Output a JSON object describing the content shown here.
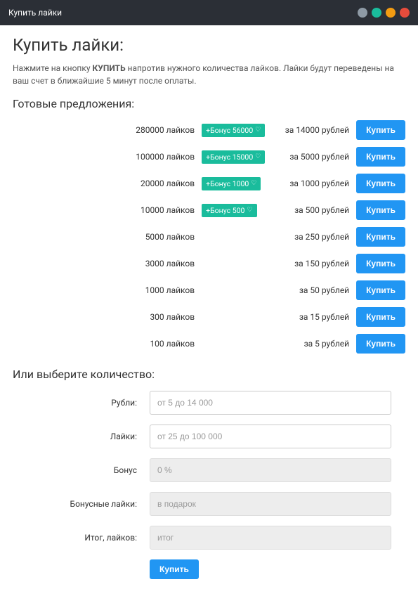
{
  "titlebar": {
    "title": "Купить лайки"
  },
  "heading": "Купить лайки:",
  "intro_pre": "Нажмите на кнопку ",
  "intro_bold": "КУПИТЬ",
  "intro_post": " напротив нужного количества лайков. Лайки будут переведены на ваш счет в ближайшие 5 минут после оплаты.",
  "offers_heading": "Готовые предложения:",
  "offers": [
    {
      "likes": "280000 лайков",
      "bonus": "+Бонус 56000",
      "price": "за 14000 рублей",
      "buy": "Купить"
    },
    {
      "likes": "100000 лайков",
      "bonus": "+Бонус 15000",
      "price": "за 5000 рублей",
      "buy": "Купить"
    },
    {
      "likes": "20000 лайков",
      "bonus": "+Бонус 1000",
      "price": "за 1000 рублей",
      "buy": "Купить"
    },
    {
      "likes": "10000 лайков",
      "bonus": "+Бонус 500",
      "price": "за 500 рублей",
      "buy": "Купить"
    },
    {
      "likes": "5000 лайков",
      "bonus": "",
      "price": "за 250 рублей",
      "buy": "Купить"
    },
    {
      "likes": "3000 лайков",
      "bonus": "",
      "price": "за 150 рублей",
      "buy": "Купить"
    },
    {
      "likes": "1000 лайков",
      "bonus": "",
      "price": "за 50 рублей",
      "buy": "Купить"
    },
    {
      "likes": "300 лайков",
      "bonus": "",
      "price": "за 15 рублей",
      "buy": "Купить"
    },
    {
      "likes": "100 лайков",
      "bonus": "",
      "price": "за 5 рублей",
      "buy": "Купить"
    }
  ],
  "custom_heading": "Или выберите количество:",
  "form": {
    "rubles_label": "Рубли:",
    "rubles_ph": "от 5 до 14 000",
    "likes_label": "Лайки:",
    "likes_ph": "от 25 до 100 000",
    "bonus_label": "Бонус",
    "bonus_ph": "0 %",
    "bonus_likes_label": "Бонусные лайки:",
    "bonus_likes_ph": "в подарок",
    "total_label": "Итог, лайков:",
    "total_ph": "итог",
    "submit": "Купить"
  }
}
